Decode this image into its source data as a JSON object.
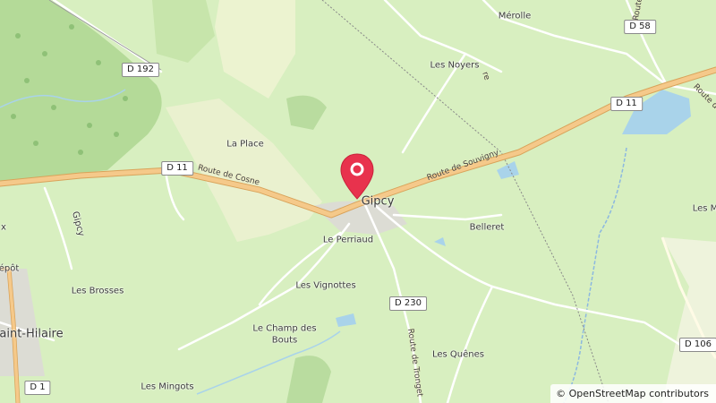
{
  "map": {
    "places": {
      "merolle": "Mérolle",
      "les_noyers": "Les Noyers",
      "la_place": "La Place",
      "gipcy": "Gipcy",
      "le_perriaud": "Le Perriaud",
      "belleret": "Belleret",
      "les_vignottes": "Les Vignottes",
      "les_brosses": "Les Brosses",
      "le_champ_des_bouts_1": "Le Champ des",
      "le_champ_des_bouts_2": "Bouts",
      "les_quenes": "Les Quênes",
      "les_mingots": "Les Mingots",
      "saint_hilaire": "aint-Hilaire",
      "depot": "épôt",
      "les_m": "Les M",
      "gipcy_road": "Gipcy",
      "x_partial": "x"
    },
    "road_refs": {
      "d192": "D 192",
      "d11_west": "D 11",
      "d11_east": "D 11",
      "d58": "D 58",
      "d230": "D 230",
      "d106": "D 106",
      "d1": "D 1"
    },
    "road_names": {
      "route_de_cosne": "Route de Cosne",
      "route_de_souvigny": "Route de Souvigny",
      "route_de_tronget": "Route de Tronget",
      "route_de_east": "Route de",
      "route_partial_top": "Route",
      "re_partial": "re"
    },
    "colors": {
      "meadow": "#d8efc0",
      "forest": "#b9dc9f",
      "water": "#a9d3ea",
      "primary_road": "#f5c98a",
      "marker": "#e8324d"
    },
    "marker_icon": "map-pin-icon"
  },
  "attribution": {
    "symbol": "©",
    "text": "OpenStreetMap contributors"
  }
}
